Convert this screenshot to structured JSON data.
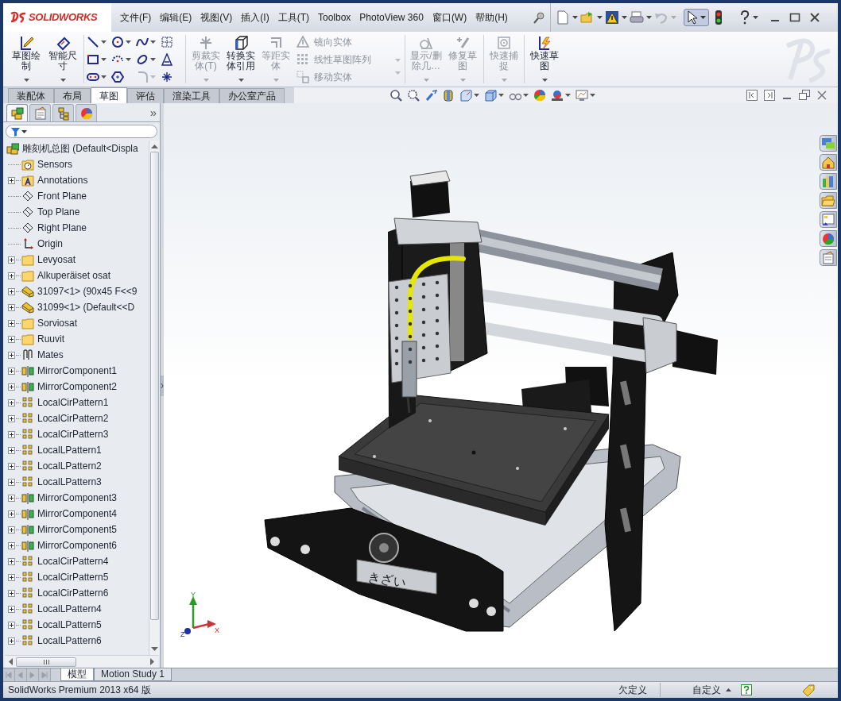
{
  "app": {
    "logo_text": "SOLIDWORKS"
  },
  "menu": [
    "文件(F)",
    "编辑(E)",
    "视图(V)",
    "插入(I)",
    "工具(T)",
    "Toolbox",
    "PhotoView 360",
    "窗口(W)",
    "帮助(H)"
  ],
  "ribbon": {
    "sketch_buttons": [
      {
        "label": "草图绘制",
        "disabled": false
      },
      {
        "label": "智能尺寸",
        "disabled": false
      }
    ],
    "edit_buttons": [
      {
        "label": "剪裁实体(T)",
        "disabled": true
      },
      {
        "label": "转换实体引用",
        "disabled": false
      },
      {
        "label": "等距实体",
        "disabled": true
      }
    ],
    "edit_list": [
      {
        "label": "镜向实体",
        "disabled": true
      },
      {
        "label": "线性草图阵列",
        "disabled": true
      },
      {
        "label": "移动实体",
        "disabled": true
      }
    ],
    "display_buttons": [
      {
        "label": "显示/删除几…",
        "disabled": true
      },
      {
        "label": "修复草图",
        "disabled": true
      }
    ],
    "snap_buttons": [
      {
        "label": "快速捕捉",
        "disabled": true
      }
    ],
    "quick_buttons": [
      {
        "label": "快速草图",
        "disabled": false
      }
    ]
  },
  "command_tabs": [
    {
      "label": "装配体",
      "selected": false
    },
    {
      "label": "布局",
      "selected": false
    },
    {
      "label": "草图",
      "selected": true
    },
    {
      "label": "评估",
      "selected": false
    },
    {
      "label": "渲染工具",
      "selected": false
    },
    {
      "label": "办公室产品",
      "selected": false
    }
  ],
  "panel": {
    "tabs": [
      {
        "selected": true
      },
      {
        "selected": false
      },
      {
        "selected": false
      },
      {
        "selected": false
      }
    ],
    "overflow_glyph": "»"
  },
  "tree": {
    "label": "雕刻机总图  (Default<Displa",
    "kind": "assembly",
    "children": [
      {
        "label": "Sensors",
        "kind": "sensor",
        "expandable": false
      },
      {
        "label": "Annotations",
        "kind": "annotation",
        "expandable": true
      },
      {
        "label": "Front Plane",
        "kind": "plane",
        "expandable": false
      },
      {
        "label": "Top Plane",
        "kind": "plane",
        "expandable": false
      },
      {
        "label": "Right Plane",
        "kind": "plane",
        "expandable": false
      },
      {
        "label": "Origin",
        "kind": "origin",
        "expandable": false
      },
      {
        "label": "Levyosat",
        "kind": "folder",
        "expandable": true
      },
      {
        "label": "Alkuperäiset osat",
        "kind": "folder",
        "expandable": true
      },
      {
        "label": "31097<1> (90x45 F<<9",
        "kind": "part",
        "expandable": true
      },
      {
        "label": "31099<1> (Default<<D",
        "kind": "part",
        "expandable": true
      },
      {
        "label": "Sorviosat",
        "kind": "folder",
        "expandable": true
      },
      {
        "label": "Ruuvit",
        "kind": "folder",
        "expandable": true
      },
      {
        "label": "Mates",
        "kind": "mates",
        "expandable": true
      },
      {
        "label": "MirrorComponent1",
        "kind": "mirror",
        "expandable": true
      },
      {
        "label": "MirrorComponent2",
        "kind": "mirror",
        "expandable": true
      },
      {
        "label": "LocalCirPattern1",
        "kind": "pattern",
        "expandable": true
      },
      {
        "label": "LocalCirPattern2",
        "kind": "pattern",
        "expandable": true
      },
      {
        "label": "LocalCirPattern3",
        "kind": "pattern",
        "expandable": true
      },
      {
        "label": "LocalLPattern1",
        "kind": "pattern",
        "expandable": true
      },
      {
        "label": "LocalLPattern2",
        "kind": "pattern",
        "expandable": true
      },
      {
        "label": "LocalLPattern3",
        "kind": "pattern",
        "expandable": true
      },
      {
        "label": "MirrorComponent3",
        "kind": "mirror",
        "expandable": true
      },
      {
        "label": "MirrorComponent4",
        "kind": "mirror",
        "expandable": true
      },
      {
        "label": "MirrorComponent5",
        "kind": "mirror",
        "expandable": true
      },
      {
        "label": "MirrorComponent6",
        "kind": "mirror",
        "expandable": true
      },
      {
        "label": "LocalCirPattern4",
        "kind": "pattern",
        "expandable": true
      },
      {
        "label": "LocalCirPattern5",
        "kind": "pattern",
        "expandable": true
      },
      {
        "label": "LocalCirPattern6",
        "kind": "pattern",
        "expandable": true
      },
      {
        "label": "LocalLPattern4",
        "kind": "pattern",
        "expandable": true
      },
      {
        "label": "LocalLPattern5",
        "kind": "pattern",
        "expandable": true
      },
      {
        "label": "LocalLPattern6",
        "kind": "pattern",
        "expandable": true
      }
    ]
  },
  "viewport": {
    "engraving": "きざい",
    "axes": [
      "X",
      "Y",
      "Z"
    ]
  },
  "bottom_tabs": [
    {
      "label": "模型",
      "selected": true
    },
    {
      "label": "Motion Study 1",
      "selected": false
    }
  ],
  "status_bar": {
    "product": "SolidWorks Premium 2013 x64 版",
    "sketch_state": "欠定义",
    "units": "自定义"
  }
}
